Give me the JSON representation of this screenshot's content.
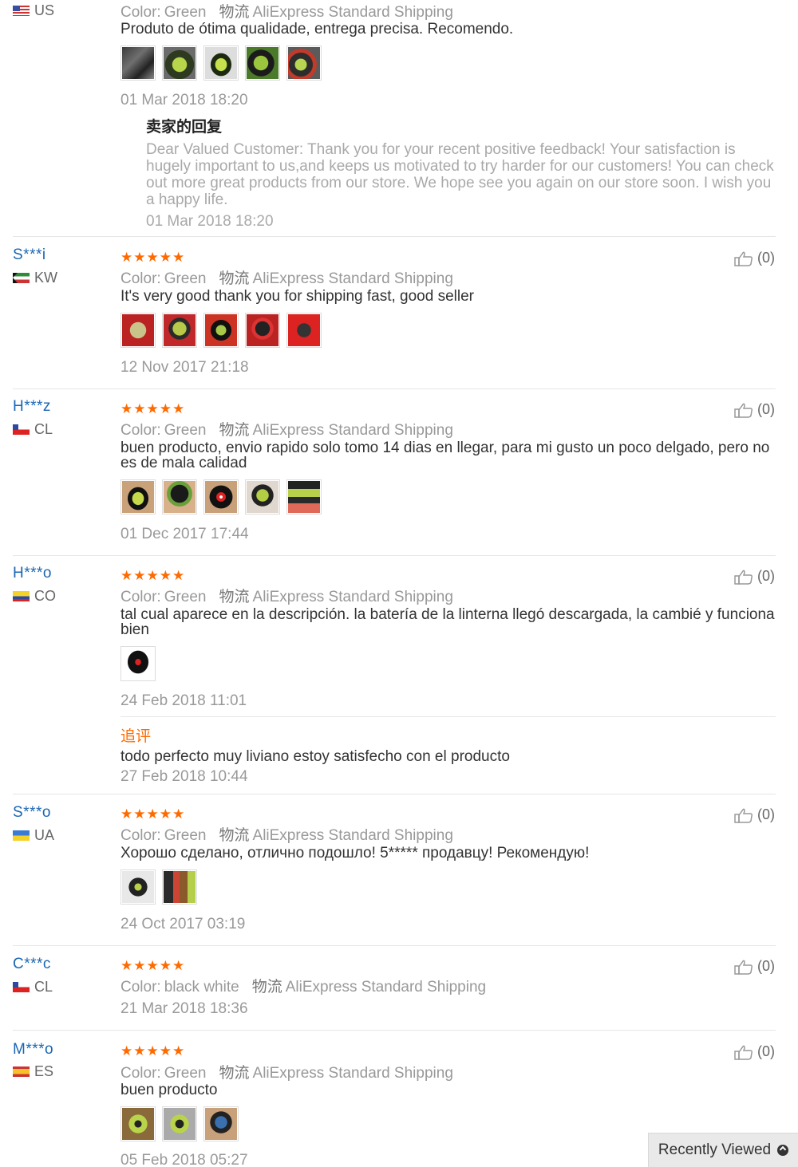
{
  "helpful_label": "(0)",
  "stars": "★★★★★",
  "labels": {
    "color_key": "Color:",
    "shipping_key": "物流",
    "shipping_value": "AliExpress Standard Shipping"
  },
  "reviews": [
    {
      "country": "US",
      "color": "Green",
      "text": "Produto de ótima qualidade, entrega precisa. Recomendo.",
      "date": "01 Mar 2018 18:20",
      "photos": [
        "green helmet photo",
        "green helmet photo",
        "green helmet photo",
        "green helmet photo",
        "green helmet photo"
      ],
      "seller_reply": {
        "title": "卖家的回复",
        "text": "Dear Valued Customer: Thank you for your recent positive feedback! Your satisfaction is hugely important to us,and keeps us motivated to try harder for our customers! You can check out more great products from our store. We hope see you again on our store soon. I wish you a happy life.",
        "date": "01 Mar 2018 18:20"
      }
    },
    {
      "user": "S***i",
      "country": "KW",
      "color": "Green",
      "text": "It's very good thank you for shipping fast, good seller",
      "date": "12 Nov 2017 21:18"
    },
    {
      "user": "H***z",
      "country": "CL",
      "color": "Green",
      "text": "buen producto, envio rapido solo tomo 14 dias en llegar, para mi gusto un poco delgado, pero no es de mala calidad",
      "date": "01 Dec 2017 17:44"
    },
    {
      "user": "H***o",
      "country": "CO",
      "color": "Green",
      "text": "tal cual aparece en la descripción. la batería de la linterna llegó descargada, la cambié y funciona bien",
      "date": "24 Feb 2018 11:01",
      "follow_up": {
        "title": "追评",
        "text": "todo perfecto muy liviano estoy satisfecho con el producto",
        "date": "27 Feb 2018 10:44"
      }
    },
    {
      "user": "S***o",
      "country": "UA",
      "color": "Green",
      "text": "Хорошо сделано, отлично подошло! 5***** продавцу! Рекомендую!",
      "date": "24 Oct 2017 03:19"
    },
    {
      "user": "C***c",
      "country": "CL",
      "color": "black white",
      "date": "21 Mar 2018 18:36"
    },
    {
      "user": "M***o",
      "country": "ES",
      "color": "Green",
      "text": "buen producto",
      "date": "05 Feb 2018 05:27"
    }
  ],
  "recently_viewed": "Recently Viewed",
  "colors": {
    "username": "#1a66b3",
    "stars": "#ff6a00",
    "follow_up_title": "#ff6a00",
    "muted": "#999999"
  }
}
